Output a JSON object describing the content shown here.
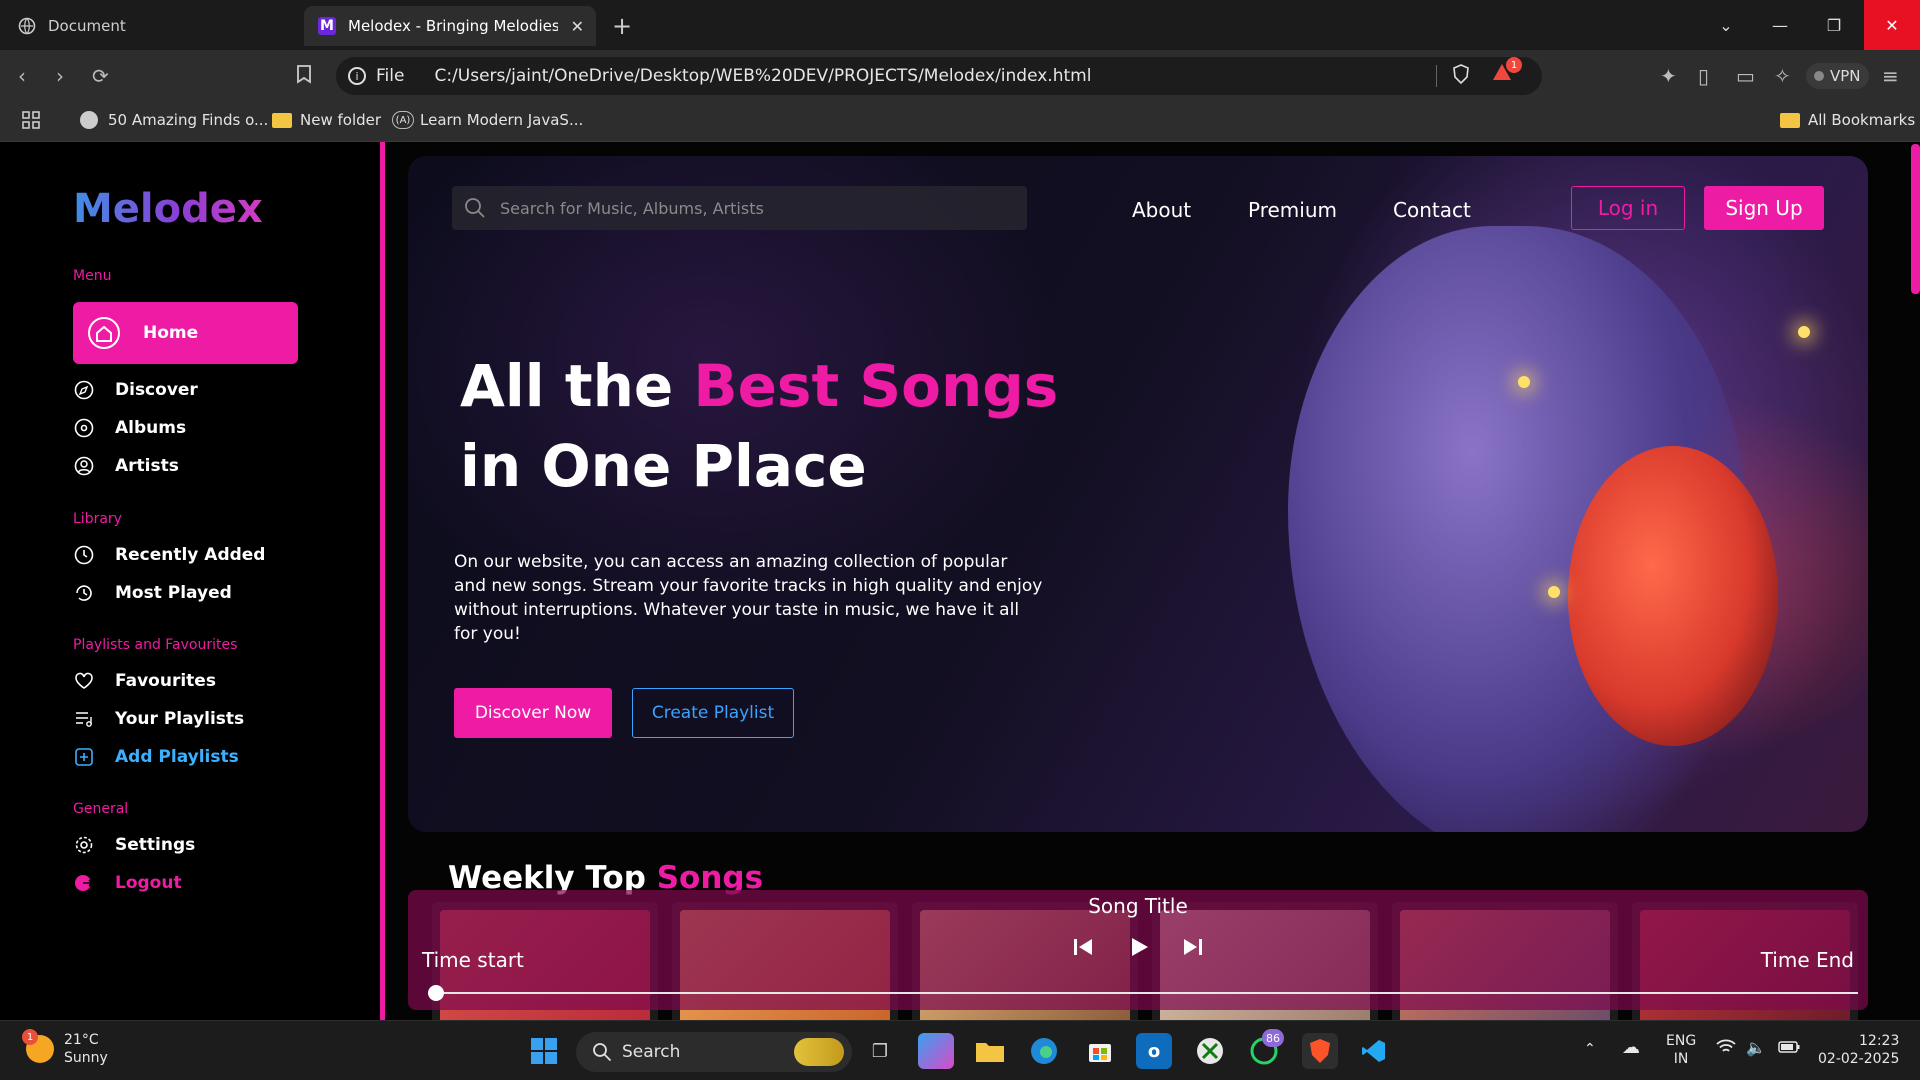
{
  "browser": {
    "tabs": [
      {
        "title": "Document"
      },
      {
        "title": "Melodex - Bringing Melodies to",
        "favicon": "M"
      }
    ],
    "url": {
      "scheme": "File",
      "path": "C:/Users/jaint/OneDrive/Desktop/WEB%20DEV/PROJECTS/Melodex/index.html"
    },
    "alert_count": "1",
    "vpn_label": "VPN",
    "bookmarks": [
      {
        "label": "50 Amazing Finds o...",
        "icon": "globe-icon"
      },
      {
        "label": "New folder",
        "icon": "folder-icon"
      },
      {
        "label": "Learn Modern JavaS...",
        "icon": "js-logo-icon"
      }
    ],
    "all_bookmarks": "All Bookmarks"
  },
  "sidebar": {
    "logo": "Melodex",
    "sections": {
      "menu": "Menu",
      "library": "Library",
      "playlists": "Playlists and Favourites",
      "general": "General"
    },
    "items": {
      "home": "Home",
      "discover": "Discover",
      "albums": "Albums",
      "artists": "Artists",
      "recently_added": "Recently Added",
      "most_played": "Most Played",
      "favourites": "Favourites",
      "your_playlists": "Your Playlists",
      "add_playlists": "Add Playlists",
      "settings": "Settings",
      "logout": "Logout"
    }
  },
  "header": {
    "search_placeholder": "Search for Music, Albums, Artists",
    "nav": {
      "about": "About",
      "premium": "Premium",
      "contact": "Contact"
    },
    "login": "Log in",
    "signup": "Sign Up"
  },
  "hero": {
    "title_start": "All the ",
    "title_highlight": "Best Songs",
    "title_end": "in One Place",
    "description": "On our website, you can access an amazing collection of popular and new songs. Stream your favorite tracks in high quality and enjoy without interruptions. Whatever your taste in music, we have it all for you!",
    "discover_button": "Discover Now",
    "create_button": "Create Playlist"
  },
  "weekly": {
    "title_start": "Weekly Top ",
    "title_highlight": "Songs"
  },
  "player": {
    "song_title": "Song Title",
    "time_start": "Time start",
    "time_end": "Time End",
    "progress": 0
  },
  "taskbar": {
    "weather_temp": "21°C",
    "weather_desc": "Sunny",
    "weather_badge": "1",
    "search_label": "Search",
    "whatsapp_badge": "86",
    "lang_top": "ENG",
    "lang_bottom": "IN",
    "time": "12:23",
    "date": "02-02-2025"
  },
  "colors": {
    "accent": "#ee1ca4",
    "link_blue": "#3aa3ff",
    "player_bg": "#7d0a4e"
  }
}
